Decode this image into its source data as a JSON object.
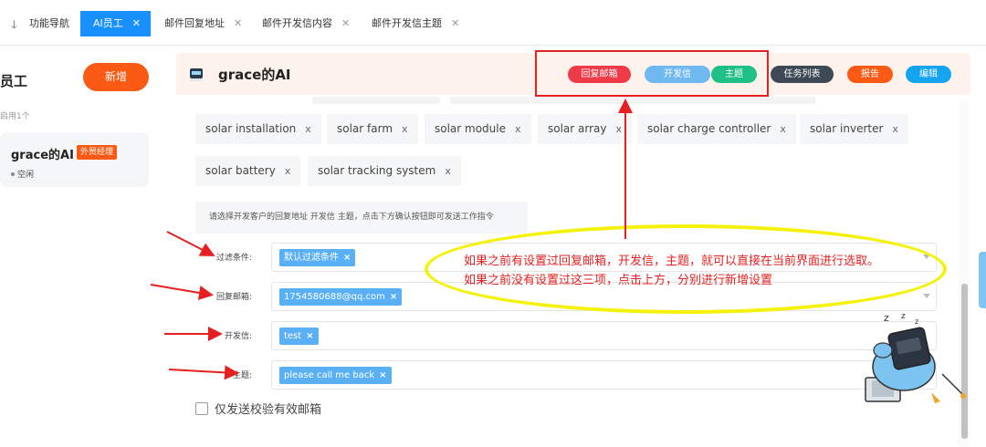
{
  "tabs": {
    "home": "功能导航",
    "active": "AI员工",
    "reply_address": "邮件回复地址",
    "dev_content": "邮件开发信内容",
    "dev_topic": "邮件开发信主题",
    "close": "✕"
  },
  "left": {
    "title": "员工",
    "add_button": "新增",
    "enabled_count": "启用1个",
    "card": {
      "name": "grace的AI",
      "tag": "外贸经理",
      "status": "空闲"
    }
  },
  "header": {
    "title": "grace的AI",
    "buttons": {
      "reply_mailbox": "回复邮箱",
      "dev_letter": "开发信",
      "topic": "主题",
      "task_list": "任务列表",
      "report": "报告",
      "edit": "编辑"
    }
  },
  "keywords": [
    "solar installation",
    "solar farm",
    "solar module",
    "solar array",
    "solar charge controller",
    "solar inverter",
    "solar battery",
    "solar tracking system"
  ],
  "keyword_close": "x",
  "hint": "请选择开发客户的回复地址 开发信 主题，点击下方确认按钮即可发送工作指令",
  "form": {
    "filter": {
      "label": "过滤条件:",
      "value": "默认过滤条件"
    },
    "reply": {
      "label": "回复邮箱:",
      "value": "1754580688@qq.com"
    },
    "dev": {
      "label": "开发信:",
      "value": "test"
    },
    "topic": {
      "label": "主题:",
      "value": "please call me back"
    },
    "chip_close": "×"
  },
  "checkbox": {
    "label": "仅发送校验有效邮箱",
    "checked": false
  },
  "annotation": {
    "line1": "如果之前有设置过回复邮箱，开发信，主题，就可以直接在当前界面进行选取。",
    "line2": "如果之前没有设置过这三项，点击上方，分别进行新增设置"
  },
  "colors": {
    "accent": "#1890ff",
    "orange": "#fa5a14",
    "red": "#ee3b47",
    "green": "#1fc085",
    "annotation_red": "#e62020",
    "highlight_yellow": "#f4f20a"
  }
}
